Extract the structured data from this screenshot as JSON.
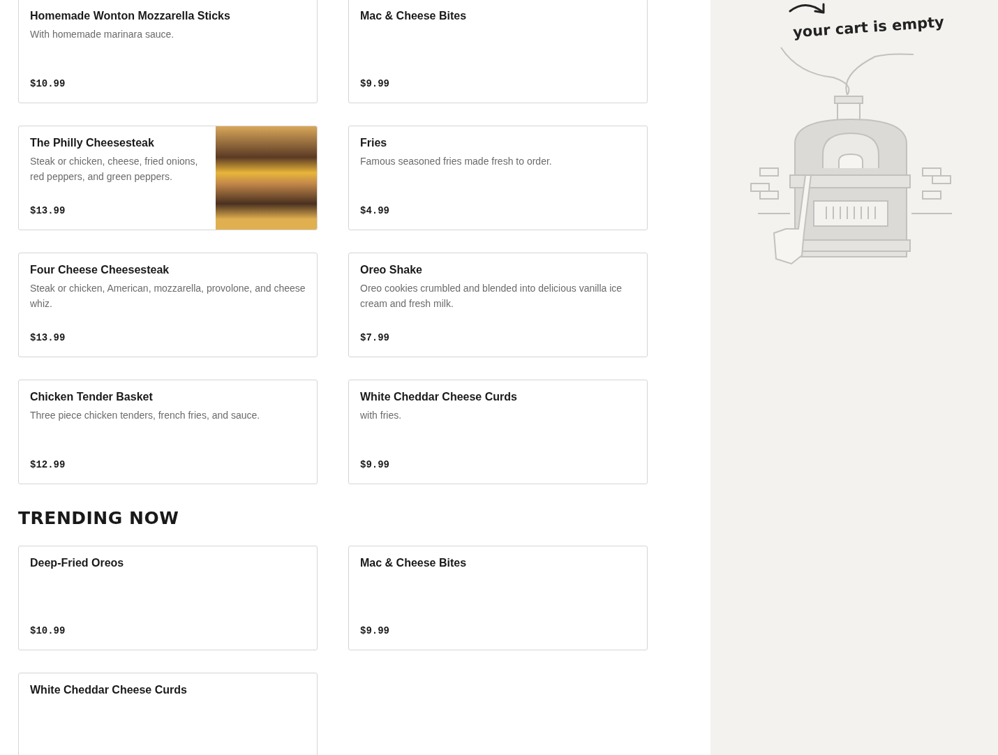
{
  "menu_items": [
    {
      "name": "Homemade Wonton Mozzarella Sticks",
      "description": "With homemade marinara sauce.",
      "price": "$10.99",
      "photo": false
    },
    {
      "name": "Mac & Cheese Bites",
      "price": "$9.99",
      "photo": false
    },
    {
      "name": "The Philly Cheesesteak",
      "description": "Steak or chicken, cheese, fried onions, red peppers, and green peppers.",
      "price": "$13.99",
      "photo": true
    },
    {
      "name": "Fries",
      "description": "Famous seasoned fries made fresh to order.",
      "price": "$4.99",
      "photo": false
    },
    {
      "name": "Four Cheese Cheesesteak",
      "description": "Steak or chicken, American, mozzarella, provolone, and cheese whiz.",
      "price": "$13.99",
      "photo": false
    },
    {
      "name": "Oreo Shake",
      "description": "Oreo cookies crumbled and blended into delicious vanilla ice cream and fresh milk.",
      "price": "$7.99",
      "photo": false
    },
    {
      "name": "Chicken Tender Basket",
      "description": "Three piece chicken tenders, french fries, and sauce.",
      "price": "$12.99",
      "photo": false
    },
    {
      "name": "White Cheddar Cheese Curds",
      "description": "with fries.",
      "price": "$9.99",
      "photo": false
    }
  ],
  "trending": {
    "title": "TRENDING NOW",
    "items": [
      {
        "name": "Deep-Fried Oreos",
        "price": "$10.99",
        "photo": false
      },
      {
        "name": "Mac & Cheese Bites",
        "price": "$9.99",
        "photo": false
      },
      {
        "name": "White Cheddar Cheese Curds",
        "photo": false
      }
    ]
  },
  "cart": {
    "message": "your cart is empty"
  }
}
